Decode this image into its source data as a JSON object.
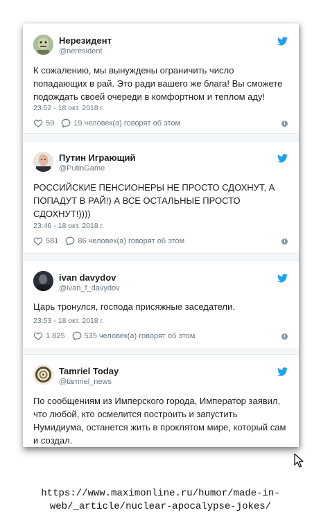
{
  "tweets": [
    {
      "name": "Нерезидент",
      "handle": "@neresident",
      "text": "К сожалению, мы вынуждены ограничить число попадающих в рай. Это ради вашего же блага! Вы сможете подождать своей очереди в комфортном и теплом аду!",
      "time": "23:52 - 18 окт. 2018 г.",
      "likes": "59",
      "replies": "19 человек(а) говорят об этом",
      "avatar_color": "#8fa885"
    },
    {
      "name": "Путин Играющий",
      "handle": "@PutinGame",
      "text": "РОССИЙСКИЕ ПЕНСИОНЕРЫ НЕ ПРОСТО СДОХНУТ, А ПОПАДУТ В РАЙ!) А ВСЕ ОСТАЛЬНЫЕ ПРОСТО СДОХНУТ!))))",
      "time": "23:46 - 18 окт. 2018 г.",
      "likes": "581",
      "replies": "86 человек(а) говорят об этом",
      "avatar_color": "#d8b49a"
    },
    {
      "name": "ivan davydov",
      "handle": "@ivan_f_davydov",
      "text": "Царь тронулся, господа присяжные заседатели.",
      "time": "23:53 - 18 окт. 2018 г.",
      "likes": "1 825",
      "replies": "535 человек(а) говорят об этом",
      "avatar_color": "#3a3f4a"
    },
    {
      "name": "Tamriel Today",
      "handle": "@tamriel_news",
      "text": "По сообщениям из Имперского города, Император заявил, что любой, кто осмелится построить и запустить Нумидиума, останется жить в проклятом мире, который сам и создал.",
      "avatar_color": "#c9b98e"
    }
  ],
  "source_url_line1": "https://www.maximonline.ru/humor/made-in-",
  "source_url_line2": "web/_article/nuclear-apocalypse-jokes/",
  "colors": {
    "twitter_blue": "#1da1f2",
    "meta_gray": "#697882"
  },
  "icons": [
    "twitter-bird-icon",
    "heart-icon",
    "reply-bubble-icon",
    "info-icon",
    "mouse-cursor-icon"
  ]
}
